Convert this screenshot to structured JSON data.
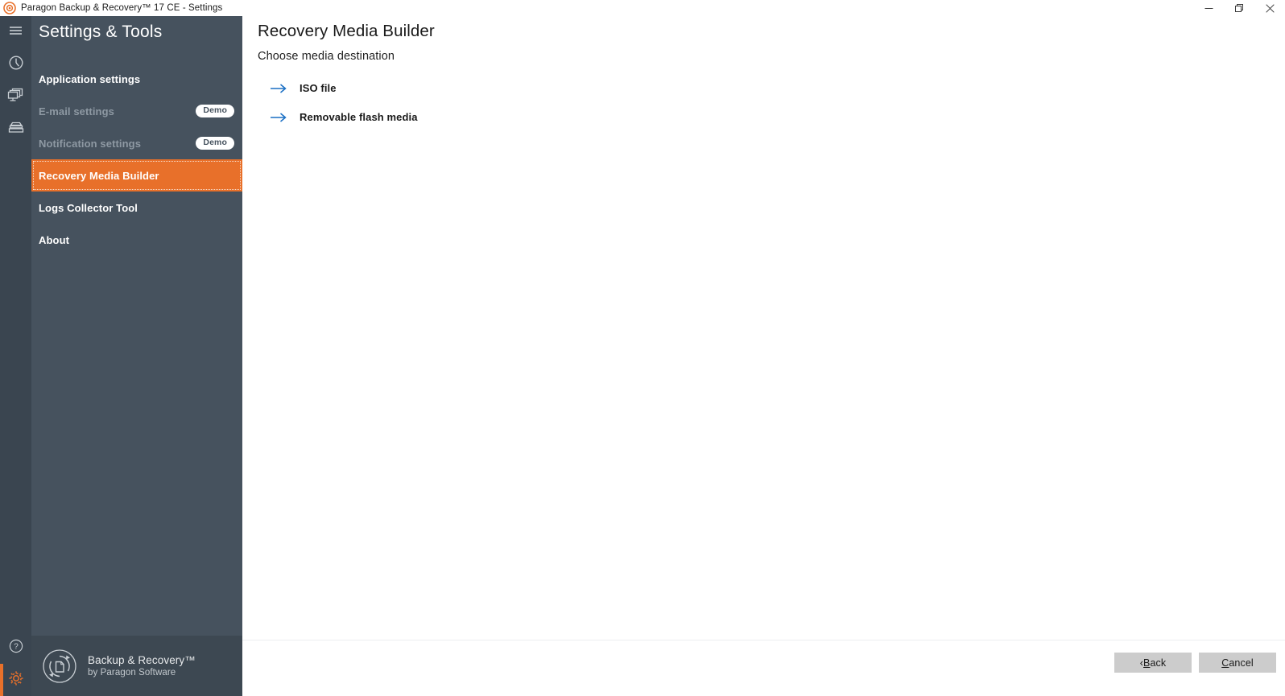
{
  "window": {
    "title": "Paragon Backup & Recovery™ 17 CE - Settings",
    "app_icon": "paragon-logo-icon",
    "controls": [
      {
        "name": "minimize",
        "glyph": "—"
      },
      {
        "name": "restore",
        "glyph": "❐"
      },
      {
        "name": "close",
        "glyph": "✕"
      }
    ]
  },
  "rail": {
    "top_items": [
      {
        "name": "hamburger-menu",
        "icon": "hamburger-icon"
      },
      {
        "name": "history",
        "icon": "clock-icon"
      },
      {
        "name": "computers",
        "icon": "monitors-icon"
      },
      {
        "name": "drives",
        "icon": "disk-stack-icon"
      }
    ],
    "bottom_items": [
      {
        "name": "help",
        "icon": "help-circle-icon",
        "active": false
      },
      {
        "name": "settings",
        "icon": "gear-icon",
        "active": true
      }
    ],
    "accent_color": "#e8702a",
    "background": "#3a4550"
  },
  "sidebar": {
    "title": "Settings & Tools",
    "background": "#46525e",
    "items": [
      {
        "label": "Application settings",
        "state": "normal",
        "badge": null
      },
      {
        "label": "E-mail settings",
        "state": "disabled",
        "badge": "Demo"
      },
      {
        "label": "Notification settings",
        "state": "disabled",
        "badge": "Demo"
      },
      {
        "label": "Recovery Media Builder",
        "state": "active",
        "badge": null
      },
      {
        "label": "Logs Collector Tool",
        "state": "normal",
        "badge": null
      },
      {
        "label": "About",
        "state": "normal",
        "badge": null
      }
    ],
    "footer": {
      "logo_icon": "backup-recovery-circle-icon",
      "product_name": "Backup & Recovery™",
      "vendor": "by Paragon Software"
    }
  },
  "main": {
    "title": "Recovery Media Builder",
    "subtitle": "Choose media destination",
    "options": [
      {
        "label": "ISO file",
        "icon": "arrow-right-icon"
      },
      {
        "label": "Removable flash media",
        "icon": "arrow-right-icon"
      }
    ],
    "buttons": [
      {
        "name": "back-button",
        "prefix": "‹ ",
        "accel": "B",
        "rest": "ack"
      },
      {
        "name": "cancel-button",
        "prefix": "",
        "accel": "C",
        "rest": "ancel"
      }
    ],
    "link_color": "#1a6fc4"
  }
}
